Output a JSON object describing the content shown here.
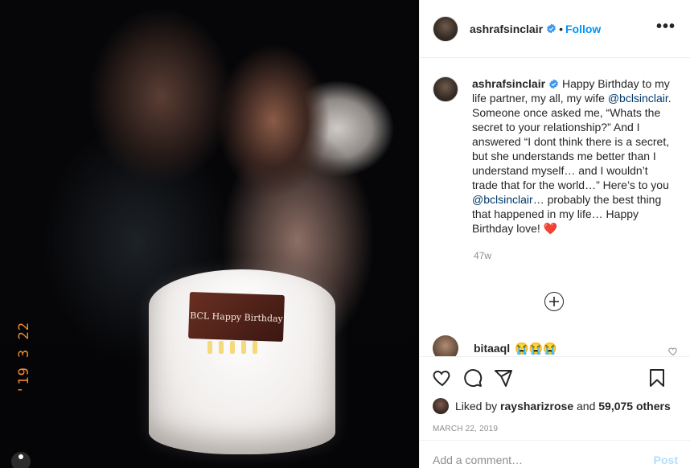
{
  "photo": {
    "cake_text": "BCL Happy Birthday",
    "date_stamp": "'19 3 22"
  },
  "header": {
    "username": "ashrafsinclair",
    "separator": "•",
    "follow_label": "Follow",
    "more_label": "•••"
  },
  "caption": {
    "username": "ashrafsinclair",
    "text_1": " Happy Birthday to my life partner, my all, my wife ",
    "mention_1": "@bclsinclair",
    "text_2": ". Someone once asked me, “Whats the secret to your relationship?” And I answered “I dont think there is a secret, but she understands me better than I understand myself… and I wouldn’t trade that for the world…” Here’s to you ",
    "mention_2": "@bclsinclair",
    "text_3": "… probably the best thing that happened in my life… Happy Birthday love! ",
    "heart": "❤️",
    "age": "47w"
  },
  "comment": {
    "username": "bitaaql",
    "text": "😭😭😭"
  },
  "likes": {
    "prefix": "Liked by ",
    "user": "raysharizrose",
    "middle": " and ",
    "count": "59,075 others"
  },
  "date": "MARCH 22, 2019",
  "add_comment": {
    "placeholder": "Add a comment…",
    "post_label": "Post"
  },
  "colors": {
    "accent": "#0095f6",
    "mention": "#00376b",
    "muted": "#8e8e8e",
    "date_stamp": "#f38a2f"
  },
  "icons": [
    "verified-badge-icon",
    "more-options-icon",
    "heart-icon",
    "comment-icon",
    "share-icon",
    "bookmark-icon",
    "plus-circle-icon",
    "small-heart-icon"
  ]
}
